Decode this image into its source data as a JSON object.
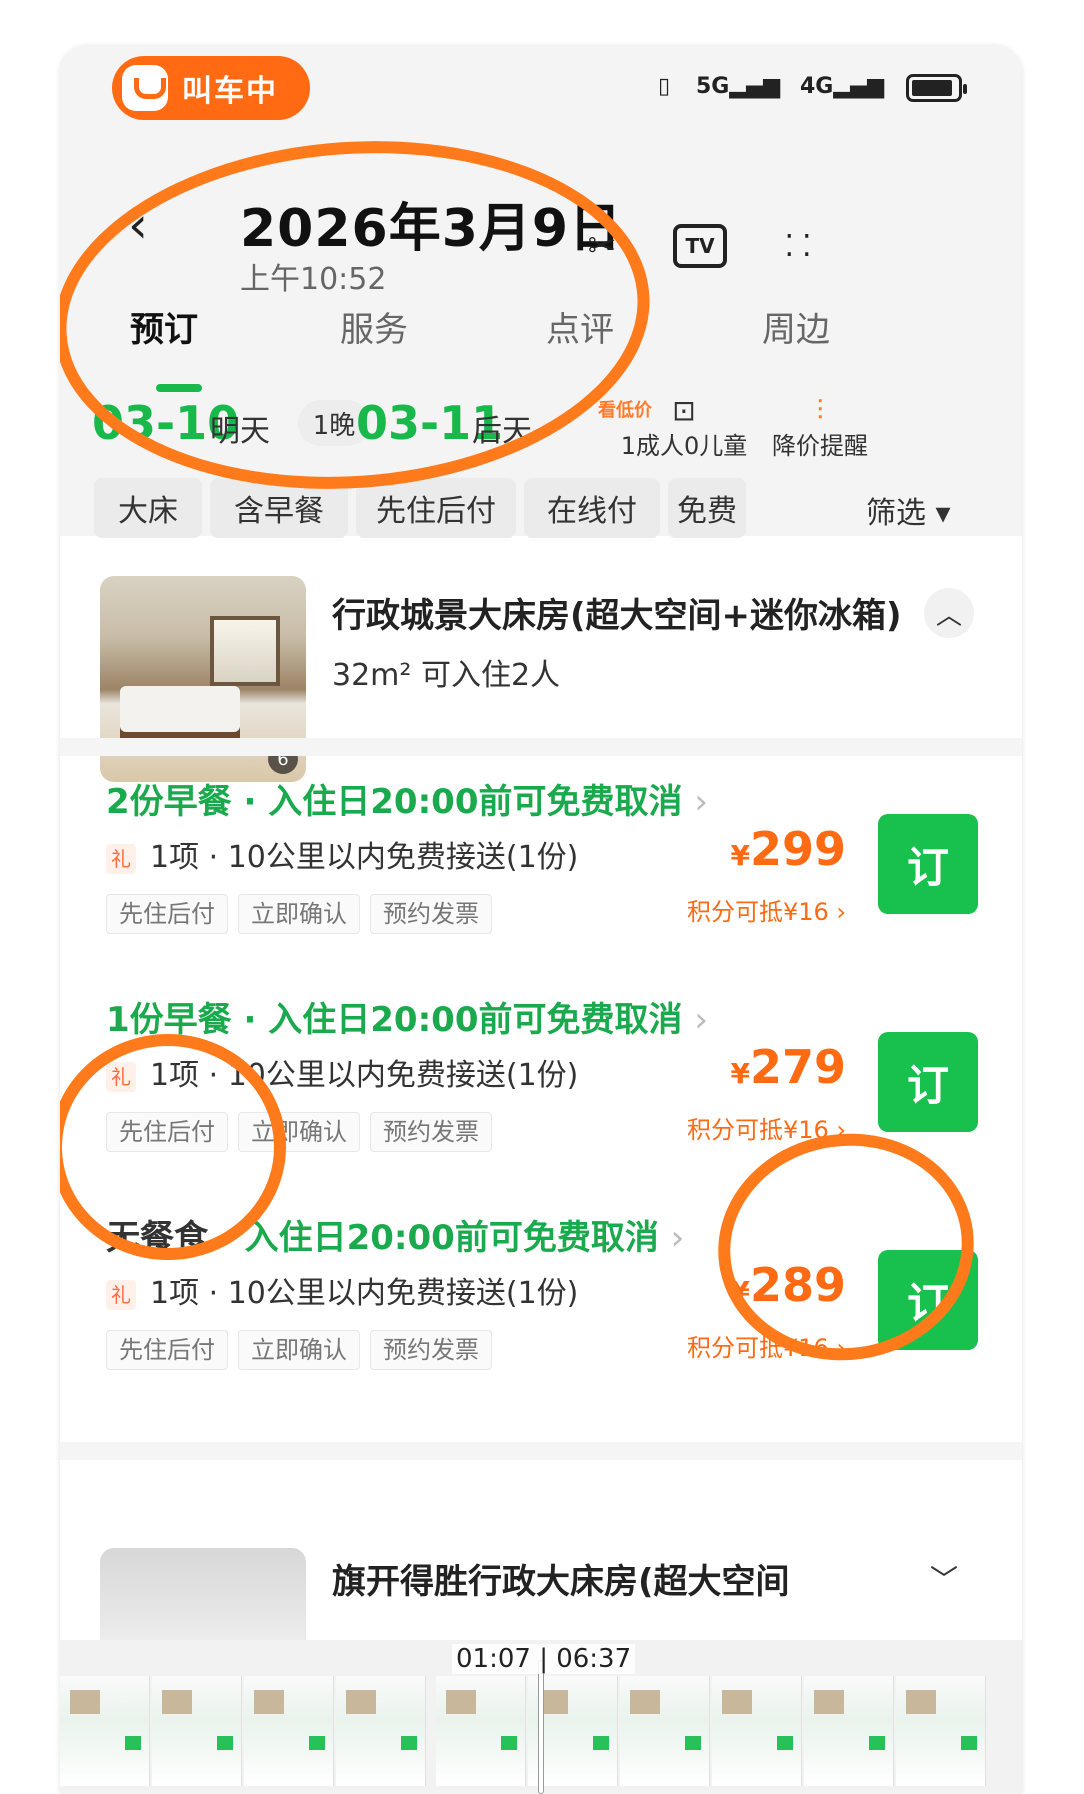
{
  "status": {
    "app_pill": "叫车中",
    "signal_5g": "5G",
    "signal_4g": "4G"
  },
  "header": {
    "date": "2026年3月9日",
    "time": "上午10:52"
  },
  "tabs": [
    "预订",
    "服务",
    "点评",
    "周边"
  ],
  "datebar": {
    "checkin": "03-10",
    "checkin_label": "明天",
    "nights": "1晚",
    "checkout": "03-11",
    "checkout_label": "后天",
    "hint": "看低价",
    "guests": "1成人0儿童",
    "price_alert": "降价提醒"
  },
  "filters": [
    "大床",
    "含早餐",
    "先住后付",
    "在线付",
    "免费"
  ],
  "filter_label": "筛选",
  "room": {
    "title": "行政城景大床房(超大空间+迷你冰箱)",
    "subtitle": "32m² 可入住2人",
    "photo_count": "6"
  },
  "rates": [
    {
      "meal": "2份早餐",
      "cancel": "入住日20:00前可免费取消",
      "gift_icon": "礼",
      "gift": "1项 · 10公里以内免费接送(1份)",
      "tags": [
        "先住后付",
        "立即确认",
        "预约发票"
      ],
      "price": "299",
      "points": "积分可抵¥16",
      "book": "订"
    },
    {
      "meal": "1份早餐",
      "cancel": "入住日20:00前可免费取消",
      "gift_icon": "礼",
      "gift": "1项 · 10公里以内免费接送(1份)",
      "tags": [
        "先住后付",
        "立即确认",
        "预约发票"
      ],
      "price": "279",
      "points": "积分可抵¥16",
      "book": "订"
    },
    {
      "meal": "无餐食",
      "cancel": "入住日20:00前可免费取消",
      "gift_icon": "礼",
      "gift": "1项 · 10公里以内免费接送(1份)",
      "tags": [
        "先住后付",
        "立即确认",
        "预约发票"
      ],
      "price": "289",
      "points": "积分可抵¥16",
      "book": "订"
    }
  ],
  "next_room": {
    "title": "旗开得胜行政大床房(超大空间"
  },
  "video": {
    "time": "01:07 | 06:37"
  },
  "colors": {
    "brand_green": "#18c04d",
    "price_orange": "#ff6a13",
    "annotation_orange": "#ff7a1a"
  }
}
